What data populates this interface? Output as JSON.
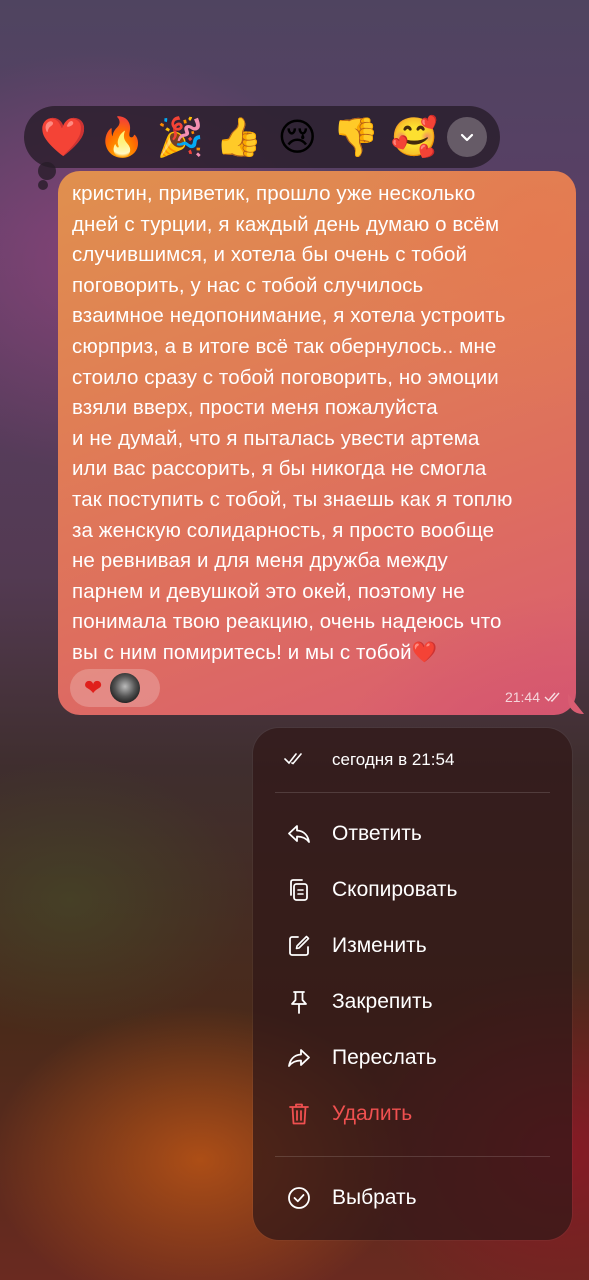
{
  "reaction_picker": {
    "emojis": [
      {
        "glyph": "❤️",
        "icon": "red-heart"
      },
      {
        "glyph": "🔥",
        "icon": "fire"
      },
      {
        "glyph": "🎉",
        "icon": "party-popper"
      },
      {
        "glyph": "👍",
        "icon": "thumbs-up"
      },
      {
        "glyph": "😢",
        "icon": "crying-face"
      },
      {
        "glyph": "👎",
        "icon": "thumbs-down"
      },
      {
        "glyph": "🥰",
        "icon": "smiling-face-with-hearts"
      }
    ],
    "expand_icon": "chevron-down-icon"
  },
  "message": {
    "text": "кристин, приветик, прошло уже несколько\nдней с турции, я каждый день думаю о всём\nслучившимся, и хотела бы очень с тобой\nпоговорить, у нас с тобой случилось\nвзаимное недопонимание, я хотела устроить\nсюрприз, а в итоге всё так обернулось.. мне\nстоило сразу с тобой поговорить, но эмоции\nвзяли вверх, прости меня пожалуйста\nи не думай, что я пыталась увести артема\nили вас рассорить, я бы никогда не смогла\nтак поступить с тобой, ты знаешь как я топлю\nза женскую солидарность, я просто вообще\nне ревнивая и для меня дружба между\nпарнем и девушкой это окей, поэтому не\nпонимала твою реакцию, очень надеюсь что\nвы с ним помиритесь! и мы с тобой❤️",
    "time": "21:44",
    "status_icon": "double-check-icon",
    "reaction": {
      "emoji": "❤",
      "icon": "red-heart"
    }
  },
  "context_menu": {
    "read_info": "сегодня в 21:54",
    "items": [
      {
        "label": "Ответить",
        "icon": "reply-icon"
      },
      {
        "label": "Скопировать",
        "icon": "copy-icon"
      },
      {
        "label": "Изменить",
        "icon": "edit-icon"
      },
      {
        "label": "Закрепить",
        "icon": "pin-icon"
      },
      {
        "label": "Переслать",
        "icon": "forward-icon"
      },
      {
        "label": "Удалить",
        "icon": "trash-icon"
      },
      {
        "label": "Выбрать",
        "icon": "select-check-icon"
      }
    ]
  },
  "colors": {
    "delete": "#f05050",
    "bubble_start": "#e0904e",
    "bubble_end": "#d95d72"
  }
}
